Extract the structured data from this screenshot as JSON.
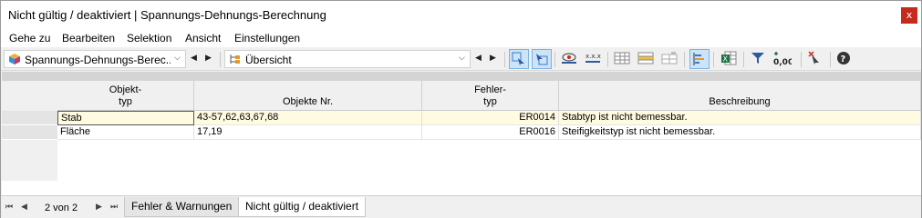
{
  "window": {
    "title": "Nicht gültig / deaktiviert | Spannungs-Dehnungs-Berechnung",
    "close_glyph": "x"
  },
  "menu": [
    "Gehe zu",
    "Bearbeiten",
    "Selektion",
    "Ansicht",
    "Einstellungen"
  ],
  "toolbar": {
    "module_select": "Spannungs-Dehnungs-Berec...",
    "view_select": "Übersicht",
    "icons": [
      "cube-colored-icon",
      "chevron-down-icon",
      "arrow-left-icon",
      "arrow-right-icon",
      "tree-icon",
      "chevron-down-icon",
      "arrow-left-icon",
      "arrow-right-icon",
      "select-object-icon",
      "select-parent-icon",
      "eye-visibility-icon",
      "xxx-hide-icon",
      "table-icon",
      "table-rows-icon",
      "table-columns-icon",
      "bar-chart-icon",
      "excel-export-icon",
      "filter-icon",
      "decimal-places-icon",
      "clear-selection-icon",
      "help-icon"
    ]
  },
  "table": {
    "columns": [
      {
        "line1": "Objekt-",
        "line2": "typ"
      },
      {
        "line1": "",
        "line2": "Objekte Nr."
      },
      {
        "line1": "Fehler-",
        "line2": "typ"
      },
      {
        "line1": "",
        "line2": "Beschreibung"
      }
    ],
    "rows": [
      {
        "type": "Stab",
        "objects": "43-57,62,63,67,68",
        "error": "ER0014",
        "description": "Stabtyp ist nicht bemessbar."
      },
      {
        "type": "Fläche",
        "objects": "17,19",
        "error": "ER0016",
        "description": "Steifigkeitstyp ist nicht bemessbar."
      }
    ]
  },
  "statusbar": {
    "page_info": "2 von 2",
    "tabs": [
      "Fehler & Warnungen",
      "Nicht gültig / deaktiviert"
    ],
    "active_tab": "Nicht gültig / deaktiviert"
  },
  "colors": {
    "selected_row": "#fffbe0",
    "active_button": "#cce4f7",
    "close_button": "#c42b1c"
  }
}
